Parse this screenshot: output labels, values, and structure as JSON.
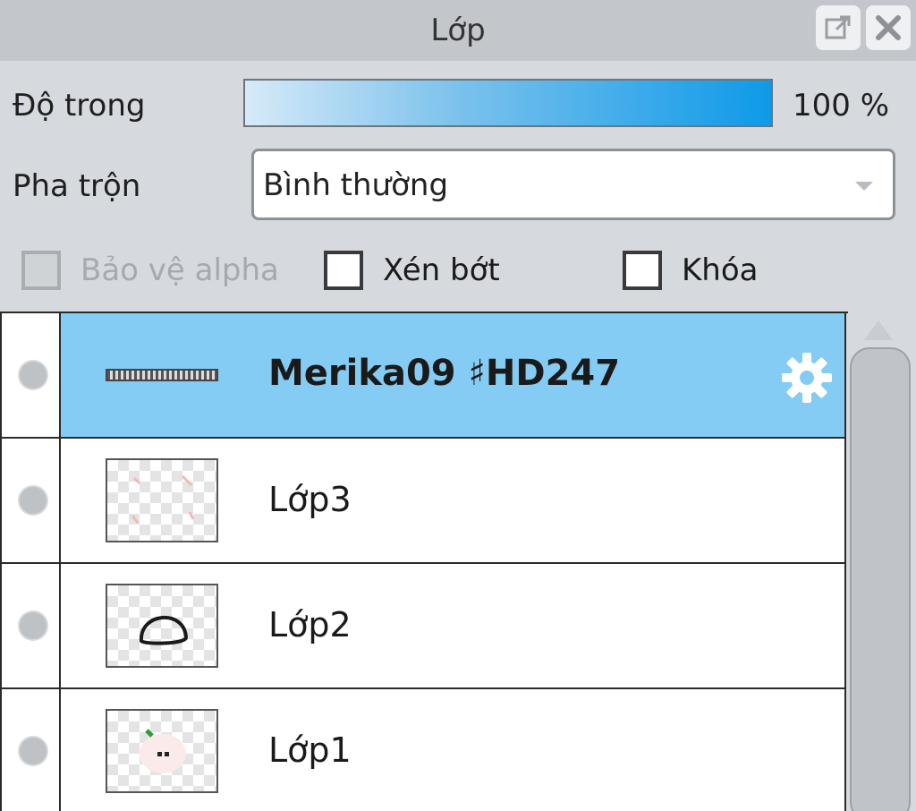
{
  "panel": {
    "title": "Lớp",
    "popout_icon": "popout-icon",
    "close_icon": "close-icon"
  },
  "opacity": {
    "label": "Độ trong",
    "value_text": "100 %",
    "value": 100
  },
  "blend": {
    "label": "Pha trộn",
    "selected": "Bình thường"
  },
  "options": {
    "protect_alpha": {
      "label": "Bảo vệ alpha",
      "checked": false,
      "enabled": false
    },
    "clip": {
      "label": "Xén bớt",
      "checked": false,
      "enabled": true
    },
    "lock": {
      "label": "Khóa",
      "checked": false,
      "enabled": true
    }
  },
  "layers": [
    {
      "name": "Merika09 ♯HD247",
      "selected": true,
      "type": "text",
      "visible": true
    },
    {
      "name": "Lớp3",
      "selected": false,
      "type": "raster",
      "visible": true
    },
    {
      "name": "Lớp2",
      "selected": false,
      "type": "raster",
      "visible": true
    },
    {
      "name": "Lớp1",
      "selected": false,
      "type": "raster",
      "visible": true
    }
  ],
  "colors": {
    "selected_row": "#84ccf3",
    "opacity_bar_end": "#0e9ae8"
  }
}
